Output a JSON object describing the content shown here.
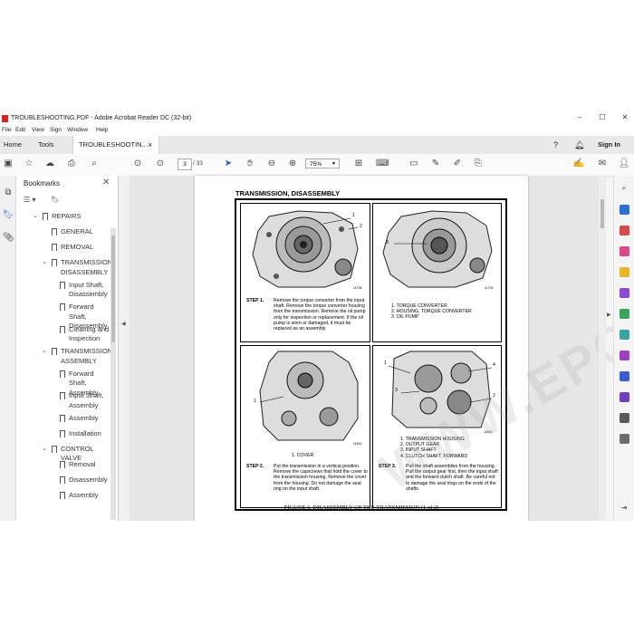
{
  "window": {
    "title": "TROUBLESHOOTING.PDF - Adobe Acrobat Reader DC (32-bit)",
    "minimize": "–",
    "maximize": "☐",
    "close": "✕"
  },
  "menu": [
    "File",
    "Edit",
    "View",
    "Sign",
    "Window",
    "Help"
  ],
  "tabs": {
    "home": "Home",
    "tools": "Tools",
    "document": "TROUBLESHOOTIN...",
    "close": "×",
    "sign_in": "Sign In"
  },
  "toolbar": {
    "current_page": "3",
    "total_pages": "/ 33",
    "zoom": "75%"
  },
  "bookmarks": {
    "title": "Bookmarks",
    "items": [
      {
        "label": "REPAIRS",
        "level": 0,
        "expanded": true
      },
      {
        "label": "GENERAL",
        "level": 1
      },
      {
        "label": "REMOVAL",
        "level": 1
      },
      {
        "label": "TRANSMISSION,\nDISASSEMBLY",
        "level": 1,
        "expanded": true
      },
      {
        "label": "Input Shaft,\nDisassembly",
        "level": 2
      },
      {
        "label": "Forward Shaft,\nDisassembly",
        "level": 2
      },
      {
        "label": "Cleaning and\nInspection",
        "level": 2
      },
      {
        "label": "TRANSMISSION,\nASSEMBLY",
        "level": 1,
        "expanded": true
      },
      {
        "label": "Forward Shaft,\nAssembly",
        "level": 2
      },
      {
        "label": "Input Shaft,\nAssembly",
        "level": 2
      },
      {
        "label": "Assembly",
        "level": 2
      },
      {
        "label": "Installation",
        "level": 2
      },
      {
        "label": "CONTROL VALVE",
        "level": 1,
        "expanded": true
      },
      {
        "label": "Removal",
        "level": 2
      },
      {
        "label": "Disassembly",
        "level": 2
      },
      {
        "label": "Assembly",
        "level": 2
      }
    ]
  },
  "document": {
    "heading": "TRANSMISSION, DISASSEMBLY",
    "watermark": "WWW.EPCATA.COM",
    "figure_caption": "FIGURE 3. DISASSEMBLY OF THE TRANSMISSION (1 of 2)",
    "step1": {
      "label": "STEP 1.",
      "text": "Remove the torque converter from the input shaft. Remove the torque converter housing from the transmission. Remove the oil pump only for inspection or replacement. If the oil pump is worn or damaged, it must be replaced as an assembly.",
      "parts": [
        "1. TORQUE CONVERTER",
        "2. HOUSING, TORQUE CONVERTER",
        "3. OIL PUMP"
      ]
    },
    "step2": {
      "label": "STEP 2.",
      "text": "Put the transmission in a vertical position. Remove the capscrews that hold the cover to the transmission housing. Remove the cover from the housing. Do not damage the seal ring on the input shaft.",
      "parts": [
        "1. COVER"
      ]
    },
    "step3": {
      "label": "STEP 3.",
      "text": "Pull the shaft assemblies from the housing. Pull the output gear first, then the input shaft and the forward clutch shaft. Be careful not to damage the seal rings on the ends of the shafts.",
      "parts": [
        "1. TRANSMISSION HOUSING",
        "2. OUTPUT GEAR",
        "3. INPUT SHAFT",
        "4. CLUTCH SHAFT, FORWARD"
      ]
    },
    "callouts": {
      "p1": [
        "1",
        "2"
      ],
      "p2": [
        "3"
      ],
      "p3": [
        "1"
      ],
      "p4": [
        "1",
        "4",
        "3",
        "2"
      ]
    },
    "figure_numbers": [
      "11708",
      "11709",
      "11810",
      "11810"
    ]
  }
}
